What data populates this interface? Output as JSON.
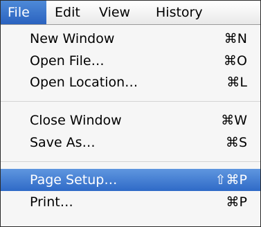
{
  "menubar": {
    "items": [
      "File",
      "Edit",
      "View",
      "History"
    ],
    "active": "File"
  },
  "menu": {
    "groups": [
      [
        {
          "label": "New Window",
          "shortcut": "⌘N"
        },
        {
          "label": "Open File…",
          "shortcut": "⌘O"
        },
        {
          "label": "Open Location…",
          "shortcut": "⌘L"
        }
      ],
      [
        {
          "label": "Close Window",
          "shortcut": "⌘W"
        },
        {
          "label": "Save As…",
          "shortcut": "⌘S"
        }
      ],
      [
        {
          "label": "Page Setup…",
          "shortcut": "⇧⌘P",
          "highlighted": true
        },
        {
          "label": "Print…",
          "shortcut": "⌘P"
        }
      ]
    ]
  },
  "colors": {
    "highlight": "#3b76cf",
    "menu_background": "#f6f6f6"
  }
}
